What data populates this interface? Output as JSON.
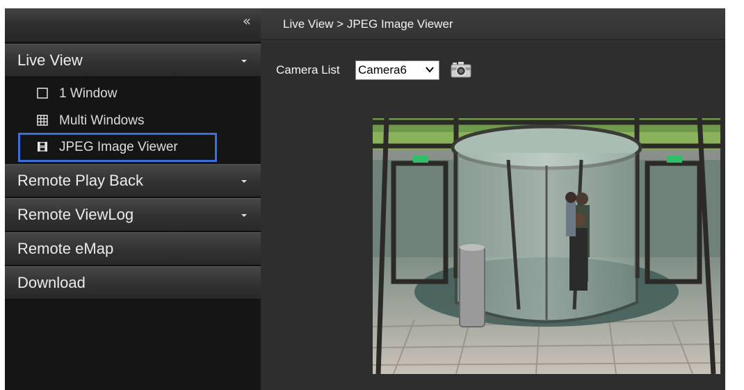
{
  "sidebar": {
    "collapse_icon": "double-chevron-left-icon",
    "collapse_glyph": "«",
    "sections": [
      {
        "label": "Live View",
        "expanded": true
      },
      {
        "label": "Remote Play Back",
        "expanded": false
      },
      {
        "label": "Remote ViewLog",
        "expanded": false
      },
      {
        "label": "Remote eMap",
        "expanded": false
      },
      {
        "label": "Download",
        "expanded": false
      }
    ],
    "live_view_items": [
      {
        "label": "1 Window",
        "icon": "single-window-icon"
      },
      {
        "label": "Multi Windows",
        "icon": "grid-windows-icon"
      },
      {
        "label": "JPEG Image Viewer",
        "icon": "film-strip-icon",
        "active": true
      }
    ],
    "active_highlight_color": "#3b6fe0"
  },
  "main": {
    "breadcrumb": "Live View > JPEG Image Viewer",
    "camera_list_label": "Camera List",
    "camera_select_value": "Camera6",
    "snapshot_icon": "camera-snapshot-icon",
    "viewer_content": "camera-feed-revolving-door-lobby"
  }
}
